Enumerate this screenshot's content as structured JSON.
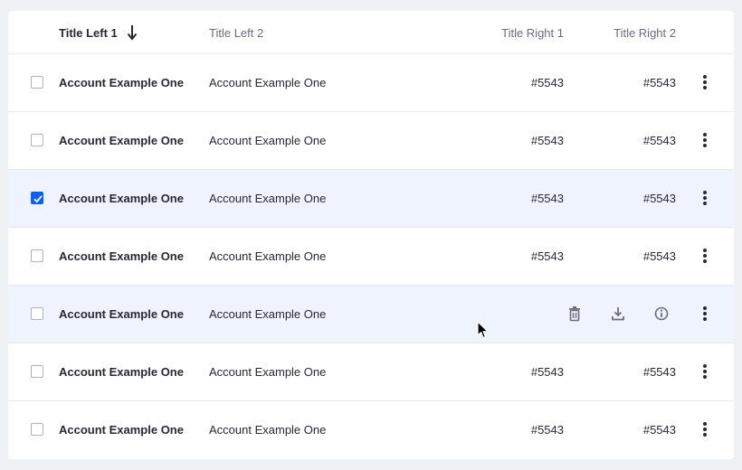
{
  "table": {
    "columns": {
      "title_left_1": "Title Left 1",
      "title_left_2": "Title Left 2",
      "title_right_1": "Title Right 1",
      "title_right_2": "Title Right 2"
    },
    "rows": [
      {
        "name": "Account Example One",
        "desc": "Account Example One",
        "r1": "#5543",
        "r2": "#5543",
        "checked": false
      },
      {
        "name": "Account Example One",
        "desc": "Account Example One",
        "r1": "#5543",
        "r2": "#5543",
        "checked": false
      },
      {
        "name": "Account Example One",
        "desc": "Account Example One",
        "r1": "#5543",
        "r2": "#5543",
        "checked": true
      },
      {
        "name": "Account Example One",
        "desc": "Account Example One",
        "r1": "#5543",
        "r2": "#5543",
        "checked": false
      },
      {
        "name": "Account Example One",
        "desc": "Account Example One",
        "r1": "",
        "r2": "",
        "checked": false,
        "hovered": true,
        "quick_actions": [
          "trash-icon",
          "download-icon",
          "info-icon"
        ]
      },
      {
        "name": "Account Example One",
        "desc": "Account Example One",
        "r1": "#5543",
        "r2": "#5543",
        "checked": false
      },
      {
        "name": "Account Example One",
        "desc": "Account Example One",
        "r1": "#5543",
        "r2": "#5543",
        "checked": false
      }
    ]
  },
  "colors": {
    "accent": "#0b5fff",
    "highlight_row": "#eef3fd",
    "page_background": "#f0f1f5",
    "text": "#272833",
    "muted_text": "#6b6c7e"
  },
  "icons": {
    "sort": "arrow-down-icon",
    "row_menu": "kebab-icon"
  }
}
